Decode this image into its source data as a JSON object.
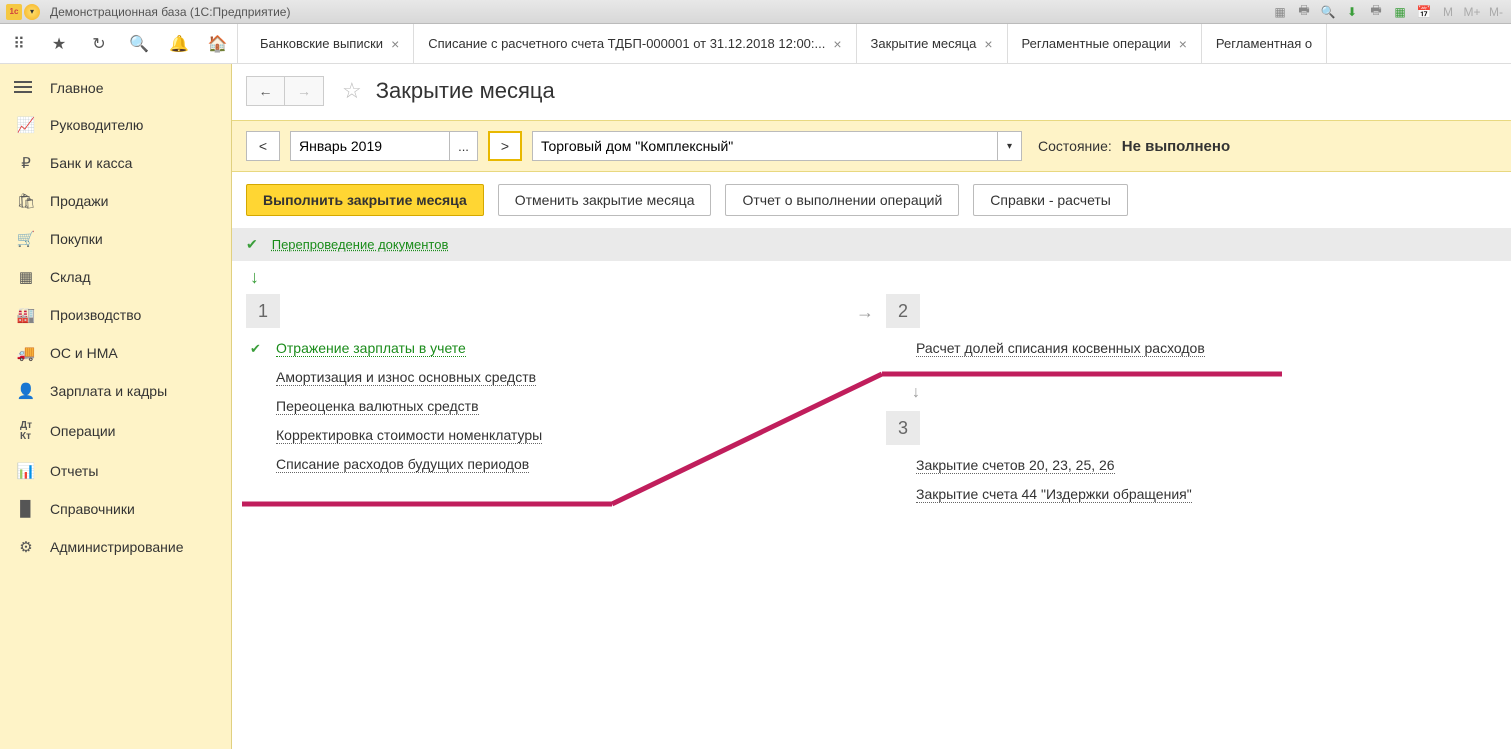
{
  "titlebar": {
    "title": "Демонстрационная база  (1С:Предприятие)"
  },
  "tabs": [
    {
      "label": "Банковские выписки"
    },
    {
      "label": "Списание с расчетного счета ТДБП-000001 от 31.12.2018 12:00:..."
    },
    {
      "label": "Закрытие месяца"
    },
    {
      "label": "Регламентные операции"
    },
    {
      "label": "Регламентная о"
    }
  ],
  "sidebar": {
    "items": [
      {
        "label": "Главное",
        "icon": "star"
      },
      {
        "label": "Руководителю",
        "icon": "chart"
      },
      {
        "label": "Банк и касса",
        "icon": "bank"
      },
      {
        "label": "Продажи",
        "icon": "cart"
      },
      {
        "label": "Покупки",
        "icon": "basket"
      },
      {
        "label": "Склад",
        "icon": "boxes"
      },
      {
        "label": "Производство",
        "icon": "factory"
      },
      {
        "label": "ОС и НМА",
        "icon": "truck"
      },
      {
        "label": "Зарплата и кадры",
        "icon": "person"
      },
      {
        "label": "Операции",
        "icon": "dtkt"
      },
      {
        "label": "Отчеты",
        "icon": "bars"
      },
      {
        "label": "Справочники",
        "icon": "book"
      },
      {
        "label": "Администрирование",
        "icon": "gear"
      }
    ]
  },
  "page": {
    "title": "Закрытие месяца",
    "period": "Январь 2019",
    "org": "Торговый дом \"Комплексный\"",
    "state_label": "Состояние:",
    "state_value": "Не выполнено",
    "actions": {
      "run": "Выполнить закрытие месяца",
      "cancel": "Отменить закрытие месяца",
      "report": "Отчет о выполнении операций",
      "refs": "Справки - расчеты"
    },
    "reprov": "Перепроведение документов",
    "stage1_num": "1",
    "stage2_num": "2",
    "stage3_num": "3",
    "ops1": [
      "Отражение зарплаты в учете",
      "Амортизация и износ основных средств",
      "Переоценка валютных средств",
      "Корректировка стоимости номенклатуры",
      "Списание расходов будущих периодов"
    ],
    "ops2": [
      "Расчет долей списания косвенных расходов"
    ],
    "ops3": [
      "Закрытие счетов 20, 23, 25, 26",
      "Закрытие счета 44 \"Издержки обращения\""
    ]
  }
}
